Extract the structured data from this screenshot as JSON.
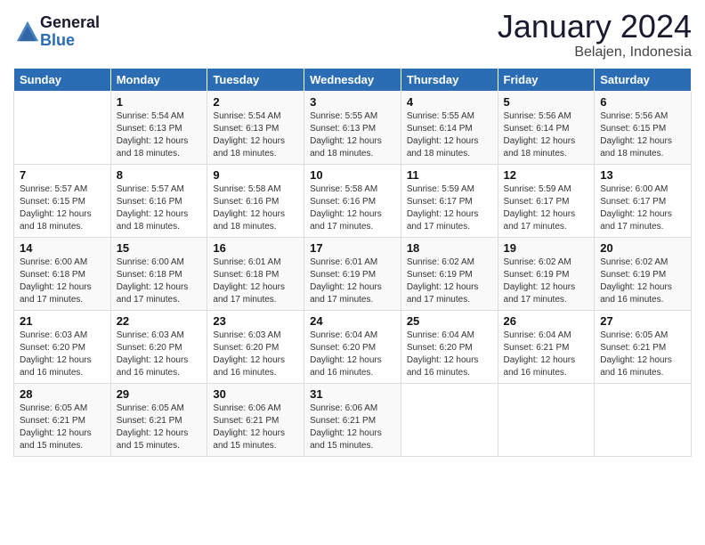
{
  "logo": {
    "general": "General",
    "blue": "Blue"
  },
  "title": "January 2024",
  "location": "Belajen, Indonesia",
  "headers": [
    "Sunday",
    "Monday",
    "Tuesday",
    "Wednesday",
    "Thursday",
    "Friday",
    "Saturday"
  ],
  "weeks": [
    [
      {
        "day": "",
        "sunrise": "",
        "sunset": "",
        "daylight": ""
      },
      {
        "day": "1",
        "sunrise": "Sunrise: 5:54 AM",
        "sunset": "Sunset: 6:13 PM",
        "daylight": "Daylight: 12 hours and 18 minutes."
      },
      {
        "day": "2",
        "sunrise": "Sunrise: 5:54 AM",
        "sunset": "Sunset: 6:13 PM",
        "daylight": "Daylight: 12 hours and 18 minutes."
      },
      {
        "day": "3",
        "sunrise": "Sunrise: 5:55 AM",
        "sunset": "Sunset: 6:13 PM",
        "daylight": "Daylight: 12 hours and 18 minutes."
      },
      {
        "day": "4",
        "sunrise": "Sunrise: 5:55 AM",
        "sunset": "Sunset: 6:14 PM",
        "daylight": "Daylight: 12 hours and 18 minutes."
      },
      {
        "day": "5",
        "sunrise": "Sunrise: 5:56 AM",
        "sunset": "Sunset: 6:14 PM",
        "daylight": "Daylight: 12 hours and 18 minutes."
      },
      {
        "day": "6",
        "sunrise": "Sunrise: 5:56 AM",
        "sunset": "Sunset: 6:15 PM",
        "daylight": "Daylight: 12 hours and 18 minutes."
      }
    ],
    [
      {
        "day": "7",
        "sunrise": "Sunrise: 5:57 AM",
        "sunset": "Sunset: 6:15 PM",
        "daylight": "Daylight: 12 hours and 18 minutes."
      },
      {
        "day": "8",
        "sunrise": "Sunrise: 5:57 AM",
        "sunset": "Sunset: 6:16 PM",
        "daylight": "Daylight: 12 hours and 18 minutes."
      },
      {
        "day": "9",
        "sunrise": "Sunrise: 5:58 AM",
        "sunset": "Sunset: 6:16 PM",
        "daylight": "Daylight: 12 hours and 18 minutes."
      },
      {
        "day": "10",
        "sunrise": "Sunrise: 5:58 AM",
        "sunset": "Sunset: 6:16 PM",
        "daylight": "Daylight: 12 hours and 17 minutes."
      },
      {
        "day": "11",
        "sunrise": "Sunrise: 5:59 AM",
        "sunset": "Sunset: 6:17 PM",
        "daylight": "Daylight: 12 hours and 17 minutes."
      },
      {
        "day": "12",
        "sunrise": "Sunrise: 5:59 AM",
        "sunset": "Sunset: 6:17 PM",
        "daylight": "Daylight: 12 hours and 17 minutes."
      },
      {
        "day": "13",
        "sunrise": "Sunrise: 6:00 AM",
        "sunset": "Sunset: 6:17 PM",
        "daylight": "Daylight: 12 hours and 17 minutes."
      }
    ],
    [
      {
        "day": "14",
        "sunrise": "Sunrise: 6:00 AM",
        "sunset": "Sunset: 6:18 PM",
        "daylight": "Daylight: 12 hours and 17 minutes."
      },
      {
        "day": "15",
        "sunrise": "Sunrise: 6:00 AM",
        "sunset": "Sunset: 6:18 PM",
        "daylight": "Daylight: 12 hours and 17 minutes."
      },
      {
        "day": "16",
        "sunrise": "Sunrise: 6:01 AM",
        "sunset": "Sunset: 6:18 PM",
        "daylight": "Daylight: 12 hours and 17 minutes."
      },
      {
        "day": "17",
        "sunrise": "Sunrise: 6:01 AM",
        "sunset": "Sunset: 6:19 PM",
        "daylight": "Daylight: 12 hours and 17 minutes."
      },
      {
        "day": "18",
        "sunrise": "Sunrise: 6:02 AM",
        "sunset": "Sunset: 6:19 PM",
        "daylight": "Daylight: 12 hours and 17 minutes."
      },
      {
        "day": "19",
        "sunrise": "Sunrise: 6:02 AM",
        "sunset": "Sunset: 6:19 PM",
        "daylight": "Daylight: 12 hours and 17 minutes."
      },
      {
        "day": "20",
        "sunrise": "Sunrise: 6:02 AM",
        "sunset": "Sunset: 6:19 PM",
        "daylight": "Daylight: 12 hours and 16 minutes."
      }
    ],
    [
      {
        "day": "21",
        "sunrise": "Sunrise: 6:03 AM",
        "sunset": "Sunset: 6:20 PM",
        "daylight": "Daylight: 12 hours and 16 minutes."
      },
      {
        "day": "22",
        "sunrise": "Sunrise: 6:03 AM",
        "sunset": "Sunset: 6:20 PM",
        "daylight": "Daylight: 12 hours and 16 minutes."
      },
      {
        "day": "23",
        "sunrise": "Sunrise: 6:03 AM",
        "sunset": "Sunset: 6:20 PM",
        "daylight": "Daylight: 12 hours and 16 minutes."
      },
      {
        "day": "24",
        "sunrise": "Sunrise: 6:04 AM",
        "sunset": "Sunset: 6:20 PM",
        "daylight": "Daylight: 12 hours and 16 minutes."
      },
      {
        "day": "25",
        "sunrise": "Sunrise: 6:04 AM",
        "sunset": "Sunset: 6:20 PM",
        "daylight": "Daylight: 12 hours and 16 minutes."
      },
      {
        "day": "26",
        "sunrise": "Sunrise: 6:04 AM",
        "sunset": "Sunset: 6:21 PM",
        "daylight": "Daylight: 12 hours and 16 minutes."
      },
      {
        "day": "27",
        "sunrise": "Sunrise: 6:05 AM",
        "sunset": "Sunset: 6:21 PM",
        "daylight": "Daylight: 12 hours and 16 minutes."
      }
    ],
    [
      {
        "day": "28",
        "sunrise": "Sunrise: 6:05 AM",
        "sunset": "Sunset: 6:21 PM",
        "daylight": "Daylight: 12 hours and 15 minutes."
      },
      {
        "day": "29",
        "sunrise": "Sunrise: 6:05 AM",
        "sunset": "Sunset: 6:21 PM",
        "daylight": "Daylight: 12 hours and 15 minutes."
      },
      {
        "day": "30",
        "sunrise": "Sunrise: 6:06 AM",
        "sunset": "Sunset: 6:21 PM",
        "daylight": "Daylight: 12 hours and 15 minutes."
      },
      {
        "day": "31",
        "sunrise": "Sunrise: 6:06 AM",
        "sunset": "Sunset: 6:21 PM",
        "daylight": "Daylight: 12 hours and 15 minutes."
      },
      {
        "day": "",
        "sunrise": "",
        "sunset": "",
        "daylight": ""
      },
      {
        "day": "",
        "sunrise": "",
        "sunset": "",
        "daylight": ""
      },
      {
        "day": "",
        "sunrise": "",
        "sunset": "",
        "daylight": ""
      }
    ]
  ]
}
